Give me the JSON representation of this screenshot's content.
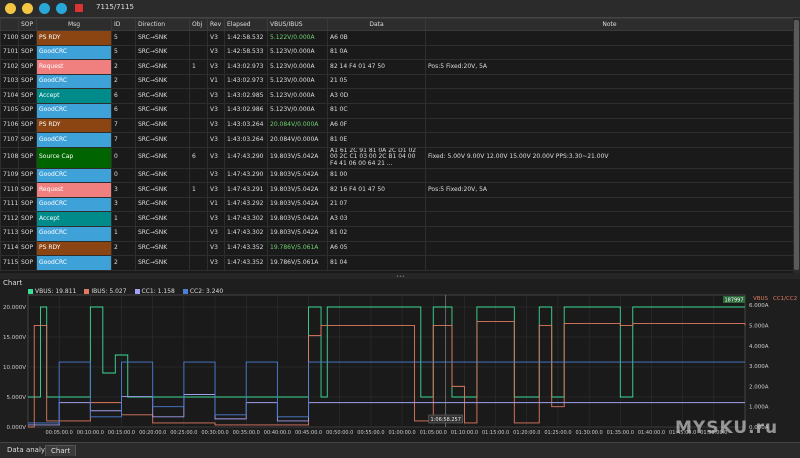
{
  "toolbar": {
    "buttons": [
      {
        "name": "open-icon",
        "color": "#f4c542"
      },
      {
        "name": "save-icon",
        "color": "#f4c542"
      },
      {
        "name": "settings-icon",
        "color": "#2aa7d9"
      },
      {
        "name": "bluetooth-icon",
        "color": "#2aa7d9"
      },
      {
        "name": "stop-icon",
        "color": "#d33"
      }
    ],
    "count": "7115/7115"
  },
  "table": {
    "headers": [
      "",
      "SOP",
      "Msg",
      "ID",
      "Direction",
      "Obj",
      "Rev",
      "Elapsed",
      "VBUS/IBUS",
      "Data",
      "Note"
    ],
    "rows": [
      {
        "idx": "7100",
        "sop": "SOP",
        "msg": "PS RDY",
        "msg_color": "#8b4513",
        "id": "5",
        "dir": "SRC→SNK",
        "obj": "",
        "rev": "V3",
        "elapsed": "1:42:58.532",
        "vbus": "5.122V/0.000A",
        "vbus_color": "#6fcf6f",
        "data": "A6 0B",
        "note": ""
      },
      {
        "idx": "7101",
        "sop": "SOP",
        "msg": "GoodCRC",
        "msg_color": "#3ea1d8",
        "id": "5",
        "dir": "SRC→SNK",
        "obj": "",
        "rev": "V3",
        "elapsed": "1:42:58.533",
        "vbus": "5.123V/0.000A",
        "vbus_color": "#dddddd",
        "data": "81 0A",
        "note": ""
      },
      {
        "idx": "7102",
        "sop": "SOP",
        "msg": "Request",
        "msg_color": "#f08080",
        "id": "2",
        "dir": "SRC→SNK",
        "obj": "1",
        "rev": "V3",
        "elapsed": "1:43:02.973",
        "vbus": "5.123V/0.000A",
        "vbus_color": "#dddddd",
        "data": "82 14 F4 01 47 50",
        "note": "Pos:5 Fixed:20V, 5A"
      },
      {
        "idx": "7103",
        "sop": "SOP",
        "msg": "GoodCRC",
        "msg_color": "#3ea1d8",
        "id": "2",
        "dir": "SRC→SNK",
        "obj": "",
        "rev": "V1",
        "elapsed": "1:43:02.973",
        "vbus": "5.123V/0.000A",
        "vbus_color": "#dddddd",
        "data": "21 05",
        "note": ""
      },
      {
        "idx": "7104",
        "sop": "SOP",
        "msg": "Accept",
        "msg_color": "#008b8b",
        "id": "6",
        "dir": "SRC→SNK",
        "obj": "",
        "rev": "V3",
        "elapsed": "1:43:02.985",
        "vbus": "5.123V/0.000A",
        "vbus_color": "#dddddd",
        "data": "A3 0D",
        "note": ""
      },
      {
        "idx": "7105",
        "sop": "SOP",
        "msg": "GoodCRC",
        "msg_color": "#3ea1d8",
        "id": "6",
        "dir": "SRC→SNK",
        "obj": "",
        "rev": "V3",
        "elapsed": "1:43:02.986",
        "vbus": "5.123V/0.000A",
        "vbus_color": "#dddddd",
        "data": "81 0C",
        "note": ""
      },
      {
        "idx": "7106",
        "sop": "SOP",
        "msg": "PS RDY",
        "msg_color": "#8b4513",
        "id": "7",
        "dir": "SRC→SNK",
        "obj": "",
        "rev": "V3",
        "elapsed": "1:43:03.264",
        "vbus": "20.084V/0.000A",
        "vbus_color": "#6fcf6f",
        "data": "A6 0F",
        "note": ""
      },
      {
        "idx": "7107",
        "sop": "SOP",
        "msg": "GoodCRC",
        "msg_color": "#3ea1d8",
        "id": "7",
        "dir": "SRC→SNK",
        "obj": "",
        "rev": "V3",
        "elapsed": "1:43:03.264",
        "vbus": "20.084V/0.000A",
        "vbus_color": "#dddddd",
        "data": "81 0E",
        "note": ""
      },
      {
        "idx": "7108",
        "sop": "SOP",
        "msg": "Source Cap",
        "msg_color": "#006400",
        "id": "0",
        "dir": "SRC→SNK",
        "obj": "6",
        "rev": "V3",
        "elapsed": "1:47:43.290",
        "vbus": "19.803V/5.042A",
        "vbus_color": "#dddddd",
        "data": "A1 61 2C 91 81 0A 2C D1 02 00 2C C1 03 00 2C B1 04 00 F4 41 06 00 64 21 ...",
        "note": "Fixed: 5.00V  9.00V  12.00V  15.00V  20.00V  PPS:3.30~21.00V"
      },
      {
        "idx": "7109",
        "sop": "SOP",
        "msg": "GoodCRC",
        "msg_color": "#3ea1d8",
        "id": "0",
        "dir": "SRC→SNK",
        "obj": "",
        "rev": "V3",
        "elapsed": "1:47:43.290",
        "vbus": "19.803V/5.042A",
        "vbus_color": "#dddddd",
        "data": "81 00",
        "note": ""
      },
      {
        "idx": "7110",
        "sop": "SOP",
        "msg": "Request",
        "msg_color": "#f08080",
        "id": "3",
        "dir": "SRC→SNK",
        "obj": "1",
        "rev": "V3",
        "elapsed": "1:47:43.291",
        "vbus": "19.803V/5.042A",
        "vbus_color": "#dddddd",
        "data": "82 16 F4 01 47 50",
        "note": "Pos:5 Fixed:20V, 5A"
      },
      {
        "idx": "7111",
        "sop": "SOP",
        "msg": "GoodCRC",
        "msg_color": "#3ea1d8",
        "id": "3",
        "dir": "SRC→SNK",
        "obj": "",
        "rev": "V1",
        "elapsed": "1:47:43.292",
        "vbus": "19.803V/5.042A",
        "vbus_color": "#dddddd",
        "data": "21 07",
        "note": ""
      },
      {
        "idx": "7112",
        "sop": "SOP",
        "msg": "Accept",
        "msg_color": "#008b8b",
        "id": "1",
        "dir": "SRC→SNK",
        "obj": "",
        "rev": "V3",
        "elapsed": "1:47:43.302",
        "vbus": "19.803V/5.042A",
        "vbus_color": "#dddddd",
        "data": "A3 03",
        "note": ""
      },
      {
        "idx": "7113",
        "sop": "SOP",
        "msg": "GoodCRC",
        "msg_color": "#3ea1d8",
        "id": "1",
        "dir": "SRC→SNK",
        "obj": "",
        "rev": "V3",
        "elapsed": "1:47:43.302",
        "vbus": "19.803V/5.042A",
        "vbus_color": "#dddddd",
        "data": "81 02",
        "note": ""
      },
      {
        "idx": "7114",
        "sop": "SOP",
        "msg": "PS RDY",
        "msg_color": "#8b4513",
        "id": "2",
        "dir": "SRC→SNK",
        "obj": "",
        "rev": "V3",
        "elapsed": "1:47:43.352",
        "vbus": "19.786V/5.061A",
        "vbus_color": "#6fcf6f",
        "data": "A6 05",
        "note": ""
      },
      {
        "idx": "7115",
        "sop": "SOP",
        "msg": "GoodCRC",
        "msg_color": "#3ea1d8",
        "id": "2",
        "dir": "SRC→SNK",
        "obj": "",
        "rev": "V3",
        "elapsed": "1:47:43.352",
        "vbus": "19.786V/5.061A",
        "vbus_color": "#dddddd",
        "data": "81 04",
        "note": ""
      }
    ]
  },
  "chart": {
    "title": "Chart",
    "legend": [
      {
        "label": "VBUS: 19.811",
        "color": "#3ddc97"
      },
      {
        "label": "IBUS: 5.027",
        "color": "#e07a5f"
      },
      {
        "label": "CC1: 1.158",
        "color": "#a0a0f0"
      },
      {
        "label": "CC2: 3.240",
        "color": "#4a7fd4"
      }
    ],
    "top_right_label": "187997",
    "right_header_vbus": "VBUS",
    "right_header_cc": "CC1/CC2",
    "cursor_label": "1:06:58.257",
    "bg_color": "#1a1a1a",
    "grid_color": "#333333"
  },
  "chart_data": {
    "type": "line",
    "title": "Chart",
    "x_ticks": [
      "00:05:00.0",
      "00:10:00.0",
      "00:15:00.0",
      "00:20:00.0",
      "00:25:00.0",
      "00:30:00.0",
      "00:35:00.0",
      "00:40:00.0",
      "00:45:00.0",
      "00:50:00.0",
      "00:55:00.0",
      "01:00:00.0",
      "01:05:00.0",
      "01:10:00.0",
      "01:15:00.0",
      "01:20:00.0",
      "01:25:00.0",
      "01:30:00.0",
      "01:35:00.0",
      "01:40:00.0",
      "01:45:00.0",
      "01:50:00.0"
    ],
    "y_left_ticks": [
      "0.000V",
      "5.000V",
      "10.000V",
      "15.000V",
      "20.000V"
    ],
    "y_left_range": [
      0,
      22
    ],
    "y_right_ticks": [
      "0.000A",
      "1.000A",
      "2.000A",
      "3.000A",
      "4.000A",
      "5.000A",
      "6.000A"
    ],
    "y_right_range": [
      0,
      6.5
    ],
    "x_range_min": [
      0,
      115
    ],
    "series": [
      {
        "name": "VBUS",
        "axis": "left",
        "color": "#3ddc97",
        "points": [
          [
            0,
            5
          ],
          [
            2,
            20
          ],
          [
            3,
            5
          ],
          [
            6,
            5
          ],
          [
            8,
            5
          ],
          [
            10,
            20
          ],
          [
            12,
            9
          ],
          [
            14,
            12
          ],
          [
            16,
            5
          ],
          [
            20,
            5
          ],
          [
            25,
            5
          ],
          [
            30,
            5
          ],
          [
            35,
            5
          ],
          [
            40,
            5
          ],
          [
            45,
            20
          ],
          [
            46,
            20
          ],
          [
            47,
            5
          ],
          [
            48,
            20
          ],
          [
            50,
            20
          ],
          [
            55,
            20
          ],
          [
            60,
            20
          ],
          [
            62,
            20
          ],
          [
            63,
            5
          ],
          [
            65,
            20
          ],
          [
            68,
            5
          ],
          [
            70,
            5
          ],
          [
            72,
            20
          ],
          [
            74,
            20
          ],
          [
            76,
            20
          ],
          [
            78,
            5
          ],
          [
            80,
            5
          ],
          [
            82,
            20
          ],
          [
            84,
            5
          ],
          [
            86,
            20
          ],
          [
            90,
            20
          ],
          [
            95,
            5
          ],
          [
            97,
            20
          ],
          [
            100,
            20
          ],
          [
            105,
            20
          ],
          [
            110,
            20
          ],
          [
            115,
            20
          ]
        ]
      },
      {
        "name": "IBUS",
        "axis": "right",
        "color": "#e07a5f",
        "points": [
          [
            0,
            0
          ],
          [
            1,
            5
          ],
          [
            2,
            5
          ],
          [
            3,
            0.3
          ],
          [
            6,
            0.3
          ],
          [
            10,
            1.2
          ],
          [
            15,
            0.6
          ],
          [
            20,
            0.2
          ],
          [
            30,
            0.1
          ],
          [
            40,
            0.1
          ],
          [
            45,
            4.5
          ],
          [
            47,
            5
          ],
          [
            55,
            5
          ],
          [
            60,
            5
          ],
          [
            62,
            0.3
          ],
          [
            65,
            5
          ],
          [
            68,
            2
          ],
          [
            70,
            0.2
          ],
          [
            72,
            5.2
          ],
          [
            78,
            0.2
          ],
          [
            82,
            5
          ],
          [
            84,
            1
          ],
          [
            86,
            5.1
          ],
          [
            95,
            5
          ],
          [
            97,
            5.1
          ],
          [
            105,
            5.1
          ],
          [
            115,
            5
          ]
        ]
      },
      {
        "name": "CC1",
        "axis": "right",
        "color": "#a0a0f0",
        "points": [
          [
            0,
            0.1
          ],
          [
            5,
            1.2
          ],
          [
            10,
            0.8
          ],
          [
            15,
            1.5
          ],
          [
            20,
            0.5
          ],
          [
            25,
            1.6
          ],
          [
            30,
            0.4
          ],
          [
            35,
            1.2
          ],
          [
            40,
            0.3
          ],
          [
            45,
            1.2
          ],
          [
            60,
            1.2
          ],
          [
            70,
            1.2
          ],
          [
            80,
            1.2
          ],
          [
            90,
            1.2
          ],
          [
            100,
            1.2
          ],
          [
            115,
            1.2
          ]
        ]
      },
      {
        "name": "CC2",
        "axis": "right",
        "color": "#4a7fd4",
        "points": [
          [
            0,
            0.2
          ],
          [
            5,
            3.2
          ],
          [
            10,
            0.5
          ],
          [
            15,
            3.2
          ],
          [
            20,
            1.0
          ],
          [
            25,
            3.2
          ],
          [
            30,
            0.6
          ],
          [
            35,
            3.2
          ],
          [
            40,
            0.5
          ],
          [
            45,
            3.2
          ],
          [
            60,
            3.2
          ],
          [
            70,
            3.2
          ],
          [
            80,
            3.2
          ],
          [
            90,
            3.2
          ],
          [
            100,
            3.2
          ],
          [
            115,
            3.2
          ]
        ]
      }
    ]
  },
  "bottom_tabs": [
    "Data analysis",
    "Chart"
  ],
  "watermark": "MYSKU.ru"
}
